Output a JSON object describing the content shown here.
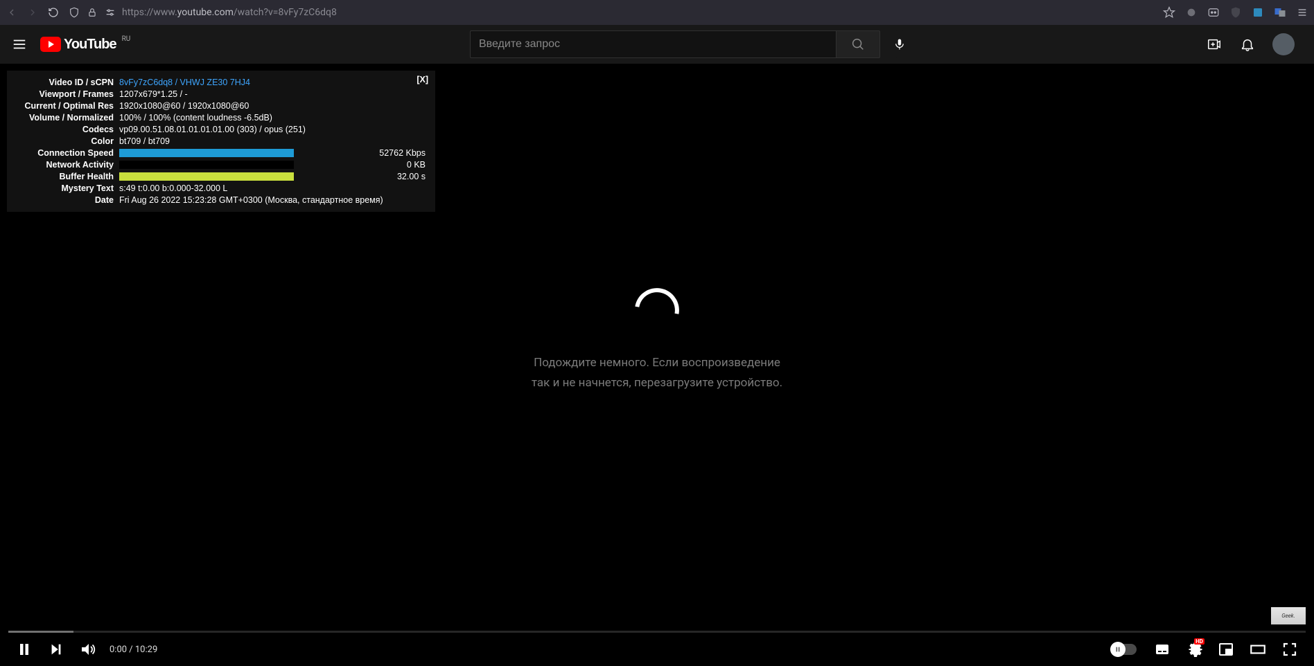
{
  "browser": {
    "url_host": "youtube.com",
    "url_scheme": "https://www.",
    "url_path": "/watch?v=8vFy7zC6dq8"
  },
  "header": {
    "logo_text": "YouTube",
    "logo_country": "RU",
    "search_placeholder": "Введите запрос"
  },
  "stats": {
    "close_label": "[X]",
    "rows": [
      {
        "label": "Video ID / sCPN",
        "value_html": "8vFy7zC6dq8   /   VHWJ  ZE30  7HJ4",
        "vid_blue": true
      },
      {
        "label": "Viewport / Frames",
        "value": "1207x679*1.25 / -"
      },
      {
        "label": "Current / Optimal Res",
        "value": "1920x1080@60 / 1920x1080@60"
      },
      {
        "label": "Volume / Normalized",
        "value": "100% / 100% (content loudness -6.5dB)"
      },
      {
        "label": "Codecs",
        "value": "vp09.00.51.08.01.01.01.01.00 (303) / opus (251)"
      },
      {
        "label": "Color",
        "value": "bt709 / bt709"
      },
      {
        "label": "Connection Speed",
        "bar": "blue",
        "right": "52762 Kbps"
      },
      {
        "label": "Network Activity",
        "bar": "none",
        "right": "0 KB"
      },
      {
        "label": "Buffer Health",
        "bar": "green",
        "right": "32.00 s"
      },
      {
        "label": "Mystery Text",
        "value": "s:49 t:0.00 b:0.000-32.000 L"
      },
      {
        "label": "Date",
        "value": "Fri Aug 26 2022 15:23:28 GMT+0300 (Москва, стандартное время)"
      }
    ]
  },
  "spinner": {
    "line1": "Подождите немного. Если воспроизведение",
    "line2": "так и не начнется, перезагрузите устройство."
  },
  "player": {
    "time": "0:00 / 10:29",
    "hd_label": "HD"
  },
  "watermark": {
    "text": "Geek."
  }
}
